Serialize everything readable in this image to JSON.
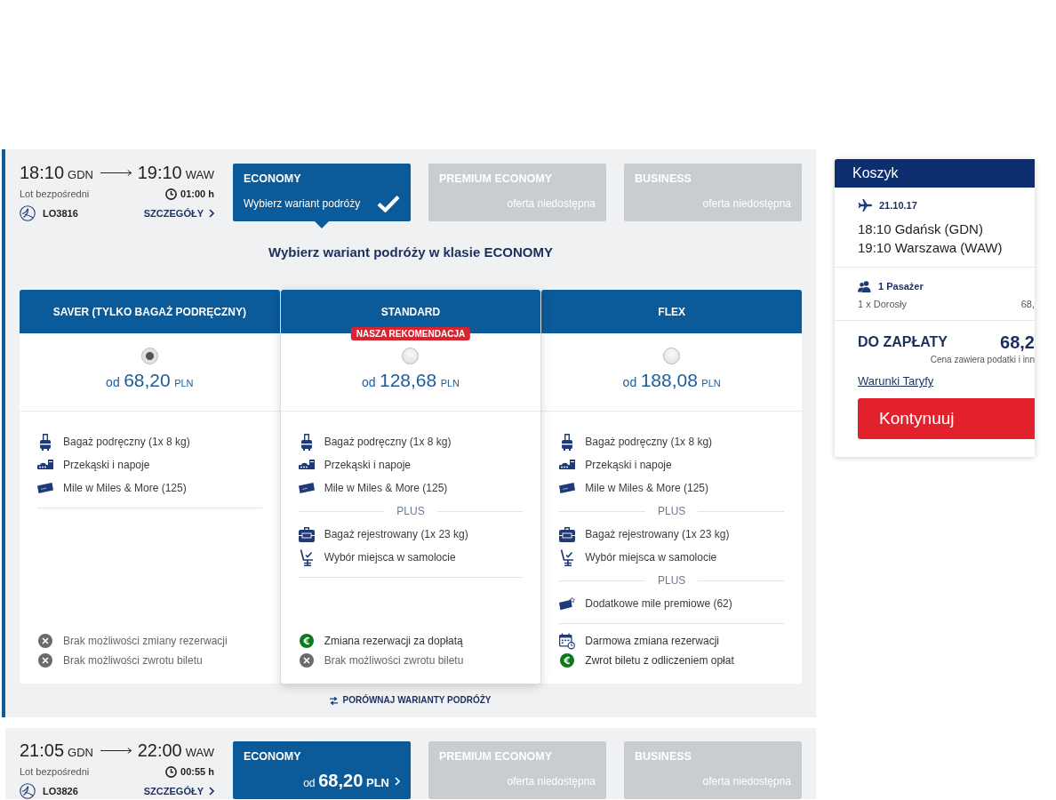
{
  "flights": [
    {
      "expanded": true,
      "departure_time": "18:10",
      "departure_code": "GDN",
      "arrival_time": "19:10",
      "arrival_code": "WAW",
      "flight_type": "Lot bezpośredni",
      "duration": "01:00 h",
      "flight_number": "LO3816",
      "details_link": "SZCZEGÓŁY",
      "classes": [
        {
          "name": "ECONOMY",
          "available": true,
          "selected": true,
          "note": "Wybierz wariant podróży"
        },
        {
          "name": "PREMIUM ECONOMY",
          "available": false,
          "selected": false,
          "note": "oferta niedostępna"
        },
        {
          "name": "BUSINESS",
          "available": false,
          "selected": false,
          "note": "oferta niedostępna"
        }
      ],
      "fares_title": "Wybierz wariant podróży w klasie ECONOMY",
      "fares": [
        {
          "name": "SAVER (TYLKO BAGAŻ PODRĘCZNY)",
          "selected": true,
          "price_prefix": "od",
          "price": "68,20",
          "currency": "PLN",
          "groups": [
            {
              "items": [
                {
                  "kind": "cabin-bag",
                  "text": "Bagaż podręczny (1x 8 kg)"
                },
                {
                  "kind": "snacks",
                  "text": "Przekąski i napoje"
                },
                {
                  "kind": "miles",
                  "text": "Mile w Miles & More (125)"
                }
              ]
            }
          ],
          "conditions": [
            {
              "kind": "none",
              "text": "Brak możliwości zmiany rezerwacji"
            },
            {
              "kind": "none",
              "text": "Brak możliwości zwrotu biletu"
            }
          ]
        },
        {
          "name": "STANDARD",
          "badge": "NASZA REKOMENDACJA",
          "selected": false,
          "price_prefix": "od",
          "price": "128,68",
          "currency": "PLN",
          "groups": [
            {
              "items": [
                {
                  "kind": "cabin-bag",
                  "text": "Bagaż podręczny (1x 8 kg)"
                },
                {
                  "kind": "snacks",
                  "text": "Przekąski i napoje"
                },
                {
                  "kind": "miles",
                  "text": "Mile w Miles & More (125)"
                }
              ]
            },
            {
              "label": "PLUS",
              "items": [
                {
                  "kind": "checked-bag",
                  "text": "Bagaż rejestrowany (1x 23 kg)"
                },
                {
                  "kind": "seat",
                  "text": "Wybór miejsca w samolocie"
                }
              ]
            }
          ],
          "conditions": [
            {
              "kind": "fee",
              "text": "Zmiana rezerwacji za dopłatą"
            },
            {
              "kind": "none",
              "text": "Brak możliwości zwrotu biletu"
            }
          ]
        },
        {
          "name": "FLEX",
          "selected": false,
          "price_prefix": "od",
          "price": "188,08",
          "currency": "PLN",
          "groups": [
            {
              "items": [
                {
                  "kind": "cabin-bag",
                  "text": "Bagaż podręczny (1x 8 kg)"
                },
                {
                  "kind": "snacks",
                  "text": "Przekąski i napoje"
                },
                {
                  "kind": "miles",
                  "text": "Mile w Miles & More (125)"
                }
              ]
            },
            {
              "label": "PLUS",
              "items": [
                {
                  "kind": "checked-bag",
                  "text": "Bagaż rejestrowany (1x 23 kg)"
                },
                {
                  "kind": "seat",
                  "text": "Wybór miejsca w samolocie"
                }
              ]
            },
            {
              "label": "PLUS",
              "items": [
                {
                  "kind": "bonus-miles",
                  "text": "Dodatkowe mile premiowe (62)"
                }
              ]
            }
          ],
          "conditions": [
            {
              "kind": "free-change",
              "text": "Darmowa zmiana rezerwacji"
            },
            {
              "kind": "fee",
              "text": "Zwrot biletu z odliczeniem opłat"
            }
          ]
        }
      ],
      "compare_link": "PORÓWNAJ WARIANTY PODRÓŻY"
    },
    {
      "expanded": false,
      "departure_time": "21:05",
      "departure_code": "GDN",
      "arrival_time": "22:00",
      "arrival_code": "WAW",
      "flight_type": "Lot bezpośredni",
      "duration": "00:55 h",
      "flight_number": "LO3826",
      "details_link": "SZCZEGÓŁY",
      "classes": [
        {
          "name": "ECONOMY",
          "available": true,
          "selected": false,
          "price_prefix": "od",
          "price": "68,20",
          "currency": "PLN"
        },
        {
          "name": "PREMIUM ECONOMY",
          "available": false,
          "selected": false,
          "note": "oferta niedostępna"
        },
        {
          "name": "BUSINESS",
          "available": false,
          "selected": false,
          "note": "oferta niedostępna"
        }
      ]
    }
  ],
  "cart": {
    "title": "Koszyk",
    "date": "21.10.17",
    "itinerary": [
      "18:10 Gdańsk (GDN)",
      "19:10 Warszawa (WAW)"
    ],
    "passengers_title": "1 Pasażer",
    "passengers": [
      {
        "label": "1 x Dorosły",
        "amount": "68,"
      }
    ],
    "total_label": "DO ZAPŁATY",
    "total": "68,2",
    "tax_note": "Cena zawiera podatki i inn",
    "terms_link": "Warunki Taryfy",
    "continue_button": "Kontynuuj"
  }
}
